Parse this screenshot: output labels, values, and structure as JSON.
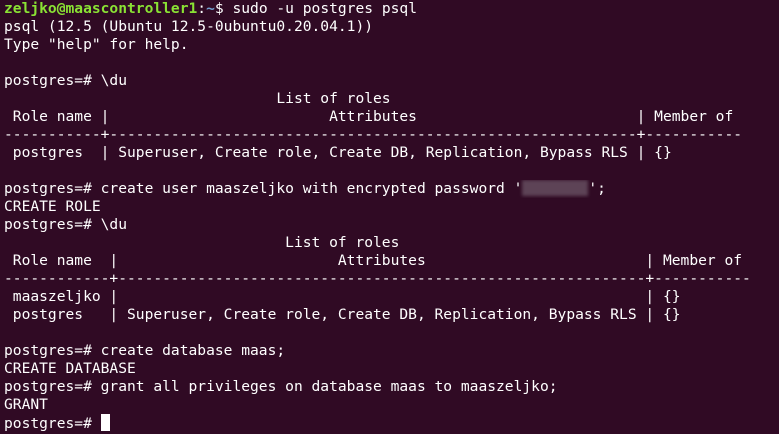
{
  "window": {
    "background": "#300a24",
    "foreground": "#ffffff",
    "prompt_user_color": "#8ae234",
    "prompt_path_color": "#729fcf"
  },
  "shell": {
    "user_host": "zeljko@maascontroller1",
    "separator": ":",
    "path": "~",
    "dollar": "$ ",
    "command": "sudo -u postgres psql"
  },
  "lines": {
    "l1": "psql (12.5 (Ubuntu 12.5-0ubuntu0.20.04.1))",
    "l2": "Type \"help\" for help.",
    "l4": "postgres=# \\du",
    "l5": "                               List of roles",
    "l6": " Role name |                         Attributes                         | Member of",
    "l7": "-----------+------------------------------------------------------------+-----------",
    "l8": " postgres  | Superuser, Create role, Create DB, Replication, Bypass RLS | {}",
    "l10_prefix": "postgres=# create user maaszeljko with encrypted password '",
    "l10_suffix": "';",
    "l11": "CREATE ROLE",
    "l12": "postgres=# \\du",
    "l13": "                                List of roles",
    "l14": " Role name  |                         Attributes                         | Member of",
    "l15": "------------+------------------------------------------------------------+-----------",
    "l16": " maaszeljko |                                                            | {}",
    "l17": " postgres   | Superuser, Create role, Create DB, Replication, Bypass RLS | {}",
    "l19": "postgres=# create database maas;",
    "l20": "CREATE DATABASE",
    "l21": "postgres=# grant all privileges on database maas to maaszeljko;",
    "l22": "GRANT",
    "l23": "postgres=# "
  }
}
